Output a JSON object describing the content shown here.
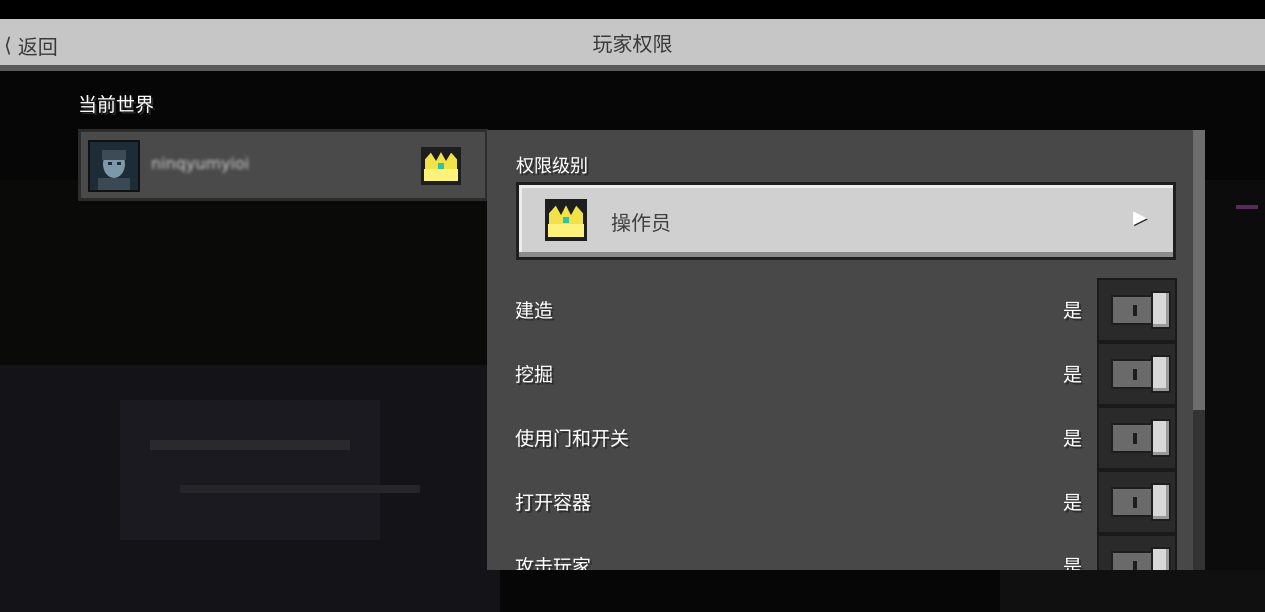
{
  "header": {
    "back_label": "返回",
    "title": "玩家权限"
  },
  "current_world": {
    "label": "当前世界",
    "player": {
      "name": "ninqyumyioi",
      "role_icon": "crown-icon"
    }
  },
  "permission_level": {
    "label": "权限级别",
    "selected": "操作员",
    "icon": "crown-icon"
  },
  "permissions": [
    {
      "label": "建造",
      "value": "是",
      "enabled": true
    },
    {
      "label": "挖掘",
      "value": "是",
      "enabled": true
    },
    {
      "label": "使用门和开关",
      "value": "是",
      "enabled": true
    },
    {
      "label": "打开容器",
      "value": "是",
      "enabled": true
    },
    {
      "label": "攻击玩家",
      "value": "是",
      "enabled": true
    }
  ],
  "colors": {
    "header_bg": "#c6c6c6",
    "panel_bg": "#484848",
    "crown": "#f2e24a"
  }
}
